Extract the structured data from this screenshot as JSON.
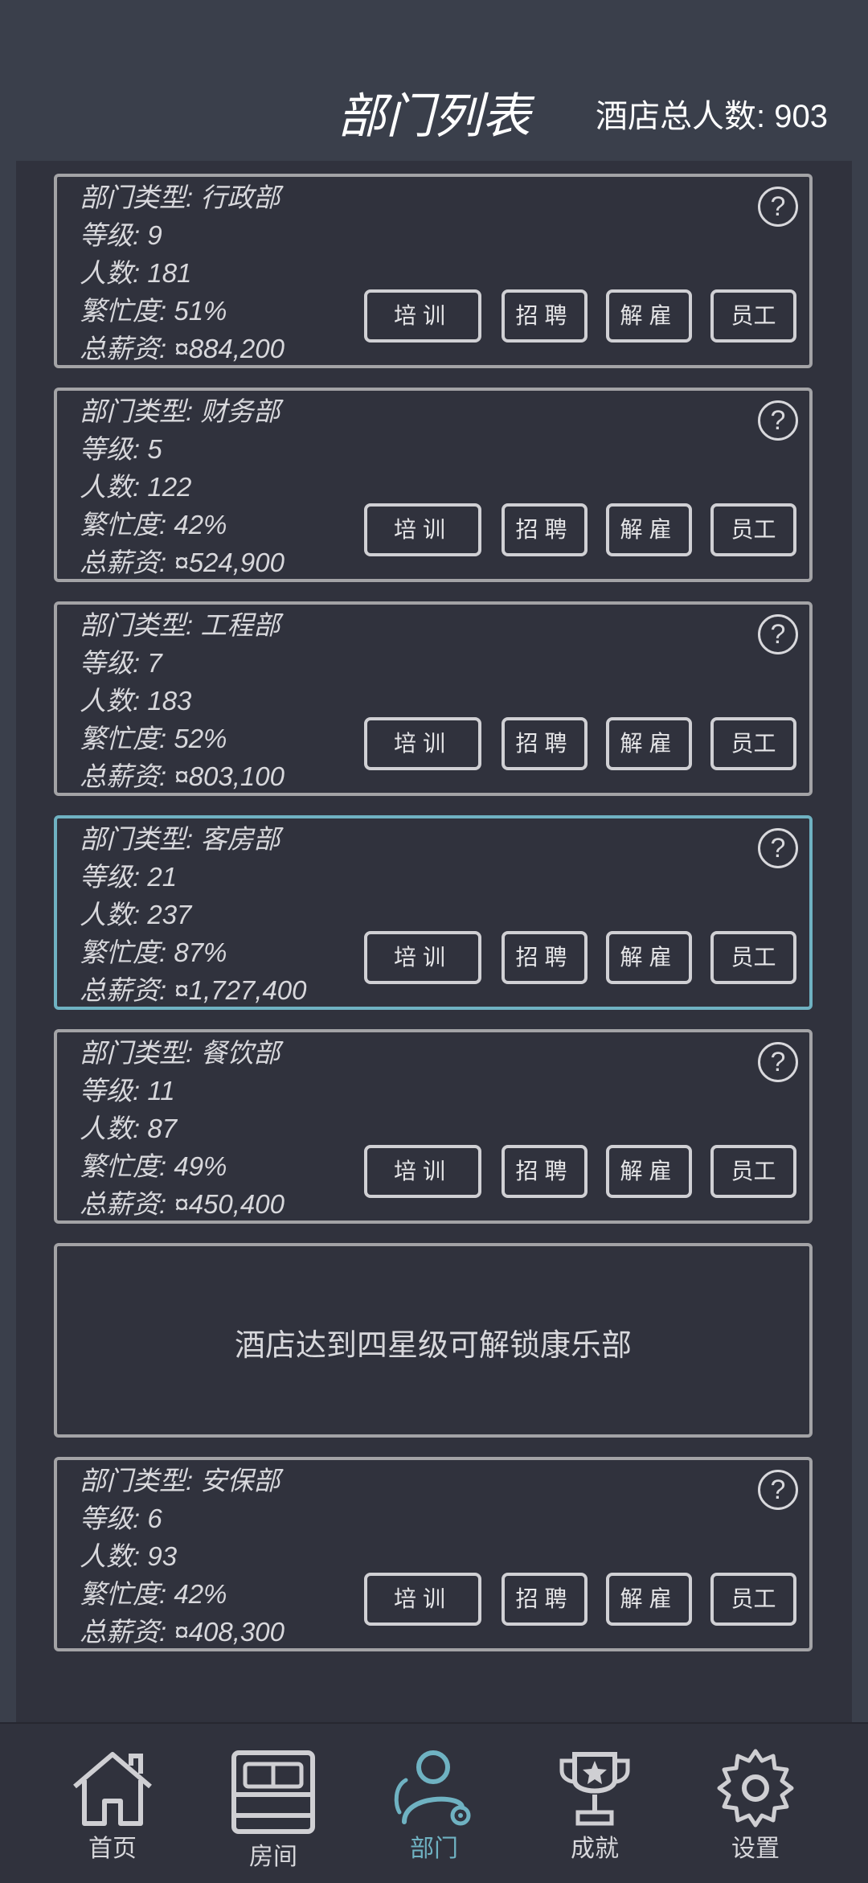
{
  "header": {
    "title": "部门列表",
    "total_label": "酒店总人数: 903"
  },
  "departments": [
    {
      "type": "部门类型: 行政部",
      "level": "等级: 9",
      "count": "人数: 181",
      "busy": "繁忙度: 51%",
      "salary": "总薪资: ¤884,200",
      "selected": false
    },
    {
      "type": "部门类型: 财务部",
      "level": "等级: 5",
      "count": "人数: 122",
      "busy": "繁忙度: 42%",
      "salary": "总薪资: ¤524,900",
      "selected": false
    },
    {
      "type": "部门类型: 工程部",
      "level": "等级: 7",
      "count": "人数: 183",
      "busy": "繁忙度: 52%",
      "salary": "总薪资: ¤803,100",
      "selected": false
    },
    {
      "type": "部门类型: 客房部",
      "level": "等级: 21",
      "count": "人数: 237",
      "busy": "繁忙度: 87%",
      "salary": "总薪资: ¤1,727,400",
      "selected": true
    },
    {
      "type": "部门类型: 餐饮部",
      "level": "等级: 11",
      "count": "人数: 87",
      "busy": "繁忙度: 49%",
      "salary": "总薪资: ¤450,400",
      "selected": false
    },
    {
      "type": "部门类型: 安保部",
      "level": "等级: 6",
      "count": "人数: 93",
      "busy": "繁忙度: 42%",
      "salary": "总薪资: ¤408,300",
      "selected": false
    }
  ],
  "buttons": {
    "train": "培训",
    "recruit": "招聘",
    "fire": "解雇",
    "staff": "员工",
    "help": "?"
  },
  "locked_message": "酒店达到四星级可解锁康乐部",
  "nav": [
    {
      "label": "首页",
      "icon": "home-icon"
    },
    {
      "label": "房间",
      "icon": "bed-icon"
    },
    {
      "label": "部门",
      "icon": "people-gear-icon",
      "active": true
    },
    {
      "label": "成就",
      "icon": "trophy-icon"
    },
    {
      "label": "设置",
      "icon": "gear-icon"
    }
  ],
  "colors": {
    "accent": "#6fb2c2",
    "background": "#30323d",
    "header": "#3a3f4b"
  }
}
